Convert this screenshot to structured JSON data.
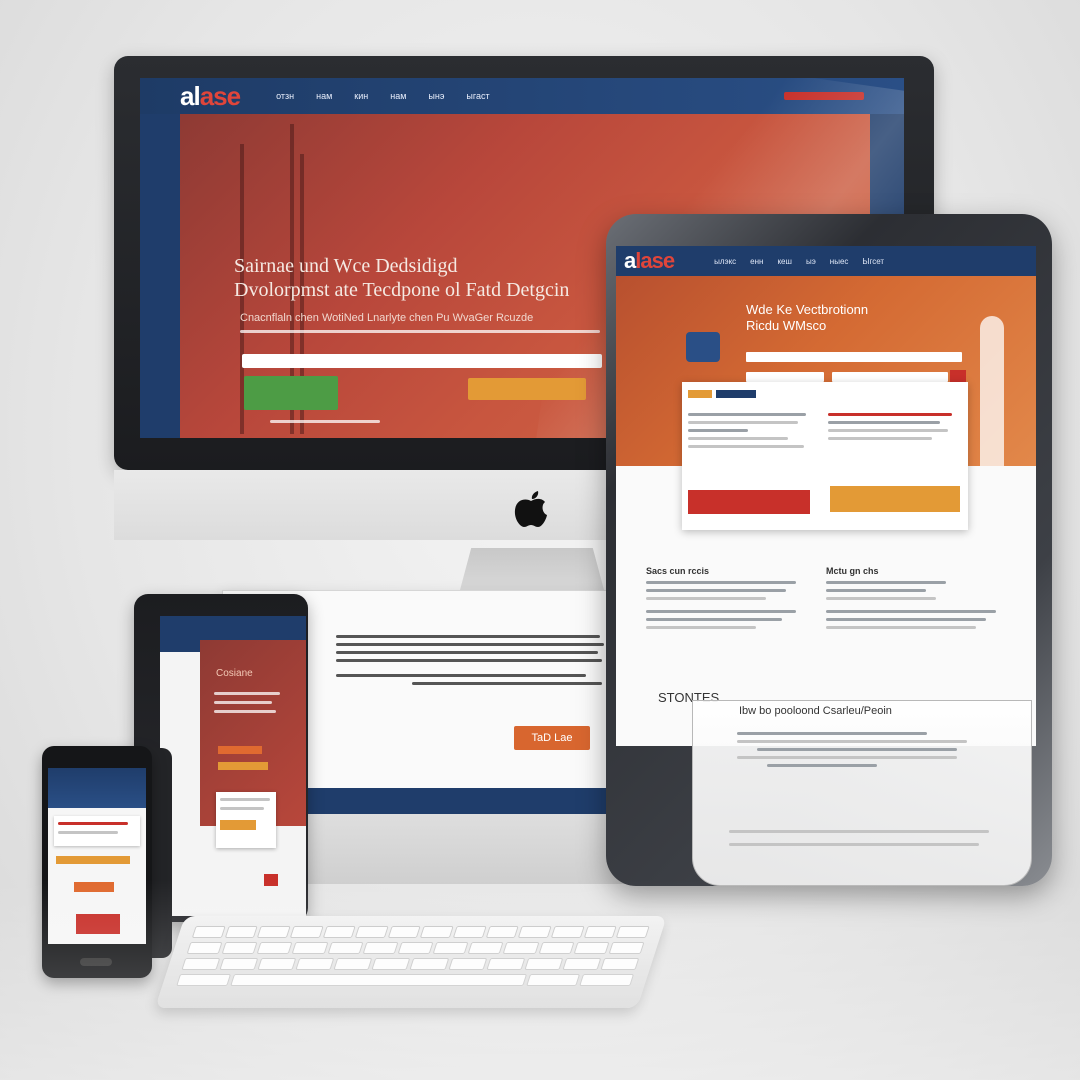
{
  "imac": {
    "logo_a": "al",
    "logo_b": "ase",
    "nav": [
      "отзн",
      "нам",
      "кин",
      "нам",
      "ынэ",
      "ыгаст"
    ],
    "nav_cta": "",
    "hero_title_1": "Sairnae und  Wce Dedsidigd",
    "hero_title_2": "Dvolorpmst ate Tecdpone ol Fatd Detgcin",
    "hero_sub_1": "Cnacnflaln chen WotiNed Lnarlyte chen Pu WvaGer Rcuzde",
    "hero_sub_2": "",
    "btn_green": "",
    "btn_orange": ""
  },
  "monitor": {
    "btn_talk": "TaD Lae"
  },
  "tablet": {
    "logo_a": "a",
    "logo_b": "lase",
    "nav": [
      "ылэкс",
      "енн",
      "кеш",
      "ыэ",
      "ныес",
      "Ыгсет"
    ],
    "hero_title_1": "Wde Ke Vectbrotionn",
    "hero_title_2": "Ricdu WMsco",
    "section_1_title": "Sacs cun rccis",
    "section_2_title": "Mctu gn chs",
    "stories": "STONTES",
    "lower_title": "Ibw bo pooloond Csarleu/Peoin"
  },
  "small_tablet": {
    "hero_title": "Cosiane"
  },
  "colors": {
    "navy": "#1f3d6b",
    "red": "#c8302a",
    "orange": "#e39a36",
    "green": "#4d9c45"
  }
}
